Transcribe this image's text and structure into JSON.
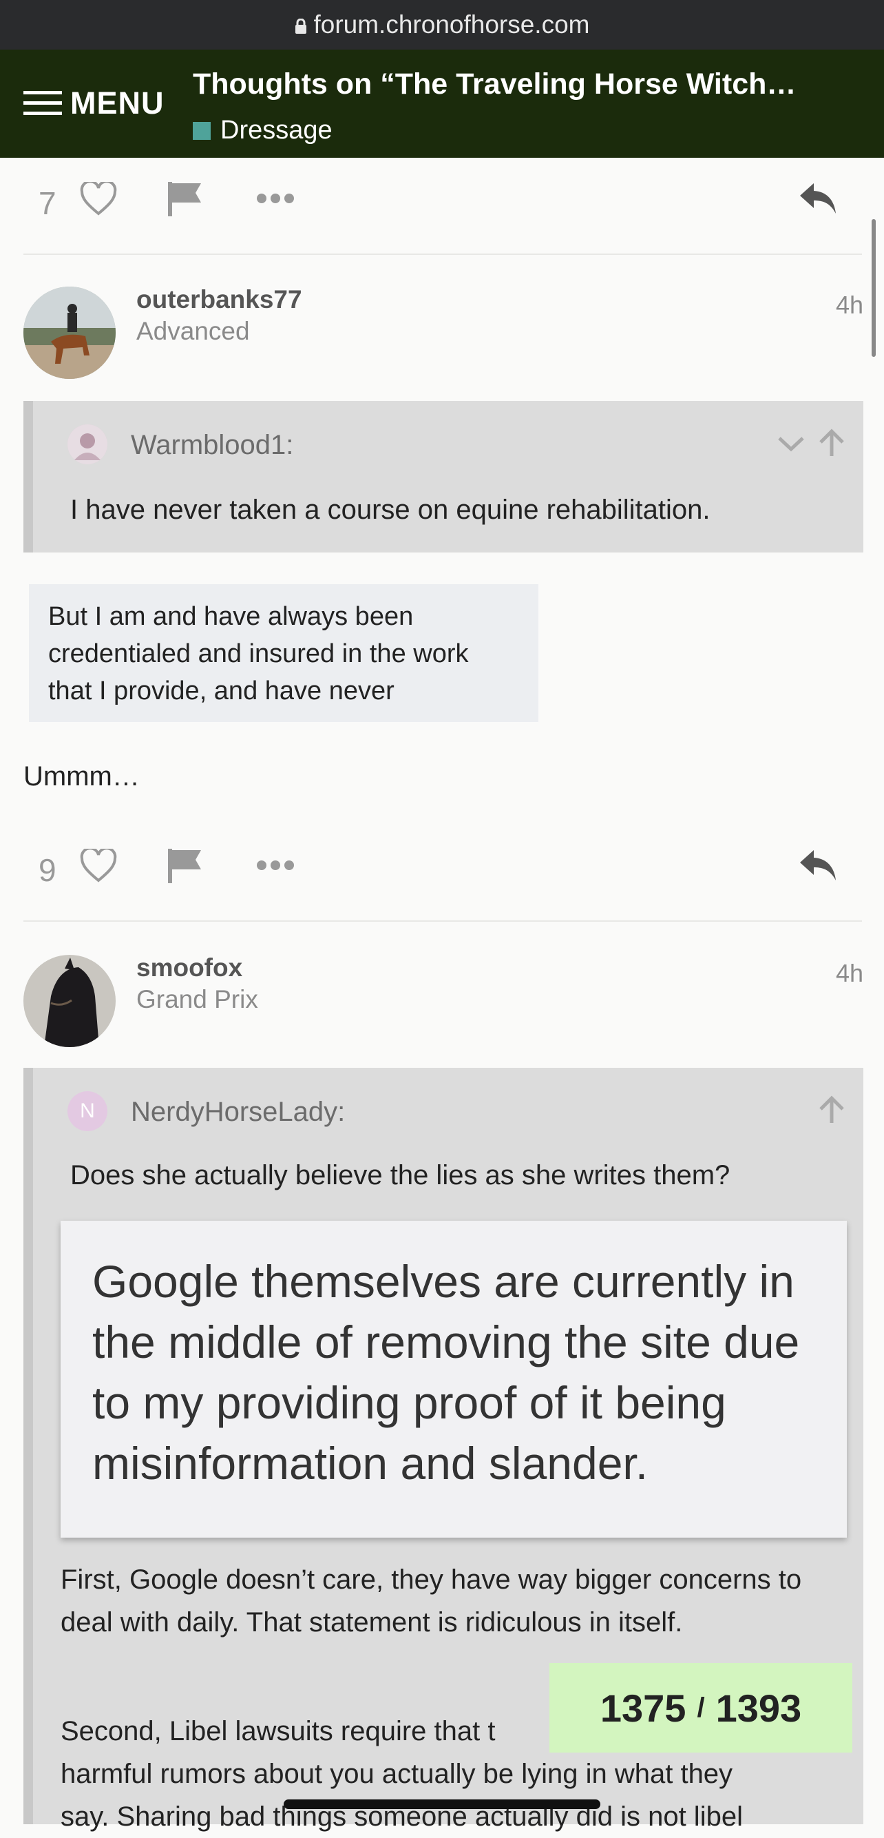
{
  "browser": {
    "url": "forum.chronofhorse.com"
  },
  "header": {
    "menu_label": "MENU",
    "topic_title": "Thoughts on “The Traveling Horse Witch…",
    "category": "Dressage",
    "category_color": "#4fa39a"
  },
  "posts": [
    {
      "likes": "7"
    },
    {
      "username": "outerbanks77",
      "user_title": "Advanced",
      "time": "4h",
      "quote": {
        "author": "Warmblood1:",
        "text": "I have never taken a course on equine rehabilitation."
      },
      "embed_text": "But I am and have always been credentialed and insured in the work that I provide, and have never",
      "body": "Ummm…",
      "likes": "9"
    },
    {
      "username": "smoofox",
      "user_title": "Grand Prix",
      "time": "4h",
      "quote": {
        "author_initial": "N",
        "author": "NerdyHorseLady:",
        "text": "Does she actually believe the lies as she writes them?",
        "embed_text": "Google themselves are currently in the middle of removing the site due to my providing proof of it being misinformation and slander.",
        "para1": "First, Google doesn’t care, they have way bigger concerns to deal with daily. That statement is ridiculous in itself.",
        "para2_line1": "Second, Libel lawsuits require that t",
        "para2_line2": "harmful rumors about you actually be lying in what they",
        "para2_line3": "say. Sharing bad things someone actually did is not libel"
      }
    }
  ],
  "progress": {
    "current": "1375",
    "separator": "/",
    "total": "1393"
  }
}
